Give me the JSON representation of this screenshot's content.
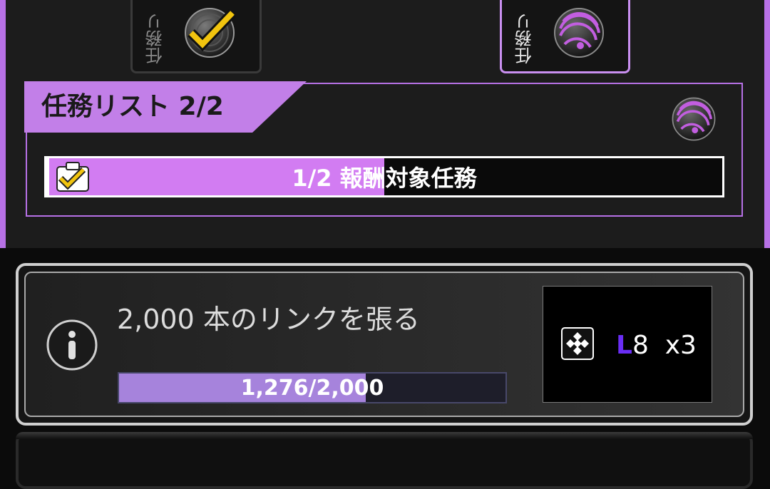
{
  "tabs": [
    {
      "label": "任務リ",
      "state": "completed",
      "icon": "checkmark-disc-icon"
    },
    {
      "label": "任務リ",
      "state": "selected",
      "icon": "purple-orb-icon"
    }
  ],
  "mission": {
    "title": "任務リスト 2/2",
    "header_icon": "purple-orb-icon",
    "progress_label": "1/2 報酬対象任務",
    "progress_fraction": 0.5,
    "progress_icon": "clipboard-check-icon"
  },
  "task": {
    "info_icon": "info-icon",
    "description": "2,000 本のリンクを張る",
    "progress_text": "1,276/2,000",
    "current": 1276,
    "total": 2000
  },
  "reward": {
    "icon": "power-cube-icon",
    "level_prefix": "L",
    "level_number": "8",
    "quantity": "x3"
  },
  "colors": {
    "accent": "#b771e6",
    "accent_fill": "#d27cf2",
    "task_fill": "#a683dc",
    "level_color": "#6a2df5"
  }
}
